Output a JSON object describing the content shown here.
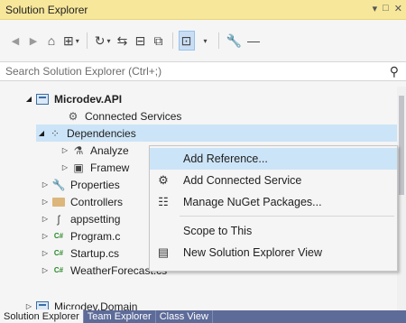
{
  "window": {
    "title": "Solution Explorer",
    "controls": [
      "▾",
      "□",
      "✕"
    ]
  },
  "toolbar": {
    "buttons": [
      {
        "name": "back-icon",
        "glyph": "◀"
      },
      {
        "name": "forward-icon",
        "glyph": "▶"
      },
      {
        "name": "home-icon",
        "glyph": "⌂"
      },
      {
        "name": "switch-views-icon",
        "glyph": "⊞"
      },
      {
        "name": "pending-changes-icon",
        "glyph": "↻"
      },
      {
        "name": "sync-icon",
        "glyph": "⇆"
      },
      {
        "name": "collapse-all-icon",
        "glyph": "⊟"
      },
      {
        "name": "show-all-files-icon",
        "glyph": "⧉"
      },
      {
        "name": "preview-selected-icon",
        "glyph": "⊡"
      },
      {
        "name": "properties-icon",
        "glyph": "🔧"
      },
      {
        "name": "dash-icon",
        "glyph": "—"
      }
    ]
  },
  "search": {
    "placeholder": "Search Solution Explorer (Ctrl+;)"
  },
  "tree": {
    "items": [
      {
        "label": "Microdev.API",
        "expander": "◢",
        "bold": true
      },
      {
        "label": "Connected Services",
        "expander": ""
      },
      {
        "label": "Dependencies",
        "expander": "◢"
      },
      {
        "label": "Analyze",
        "expander": "▷"
      },
      {
        "label": "Framew",
        "expander": "▷"
      },
      {
        "label": "Properties",
        "expander": "▷"
      },
      {
        "label": "Controllers",
        "expander": "▷"
      },
      {
        "label": "appsetting",
        "expander": "▷"
      },
      {
        "label": "Program.c",
        "expander": "▷"
      },
      {
        "label": "Startup.cs",
        "expander": "▷"
      },
      {
        "label": "WeatherForecast.cs",
        "expander": "▷"
      },
      {
        "label": "Microdev.Domain",
        "expander": "▷"
      }
    ]
  },
  "context_menu": {
    "items": [
      {
        "label": "Add Reference...",
        "icon": ""
      },
      {
        "label": "Add Connected Service",
        "icon": "⚙"
      },
      {
        "label": "Manage NuGet Packages...",
        "icon": "☷"
      },
      {
        "label": "Scope to This",
        "icon": ""
      },
      {
        "label": "New Solution Explorer View",
        "icon": "▤"
      }
    ]
  },
  "tabs": [
    "Solution Explorer",
    "Team Explorer",
    "Class View"
  ]
}
